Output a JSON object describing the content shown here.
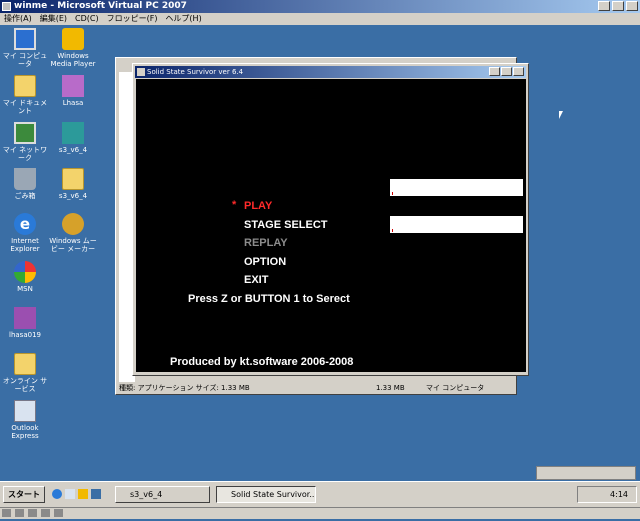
{
  "vpc": {
    "title": "winme - Microsoft Virtual PC 2007",
    "menu": [
      "操作(A)",
      "編集(E)",
      "CD(C)",
      "フロッピー(F)",
      "ヘルプ(H)"
    ]
  },
  "desktop": {
    "icons": [
      {
        "label": "マイ コンピュータ",
        "icon": "my-computer-icon"
      },
      {
        "label": "Windows Media Player",
        "icon": "media-player-icon"
      },
      {
        "label": "マイ ドキュメント",
        "icon": "my-documents-icon"
      },
      {
        "label": "Lhasa",
        "icon": "lhasa-icon"
      },
      {
        "label": "マイ ネットワーク",
        "icon": "network-icon"
      },
      {
        "label": "s3_v6_4",
        "icon": "s3-zip-icon"
      },
      {
        "label": "ごみ箱",
        "icon": "recycle-bin-icon"
      },
      {
        "label": "s3_v6_4",
        "icon": "folder-icon"
      },
      {
        "label": "Internet Explorer",
        "icon": "ie-icon"
      },
      {
        "label": "Windows ムービー メーカー",
        "icon": "movie-maker-icon"
      },
      {
        "label": "MSN",
        "icon": "msn-icon"
      },
      {
        "label": "lhasa019",
        "icon": "lhasa019-icon"
      },
      {
        "label": "オンライン サービス",
        "icon": "folder-icon"
      },
      {
        "label": "Outlook Express",
        "icon": "outlook-express-icon"
      }
    ]
  },
  "explorer": {
    "status_left": "種類: アプリケーション サイズ: 1.33 MB",
    "status_size": "1.33 MB",
    "status_location": "マイ コンピュータ"
  },
  "game": {
    "title": "Solid State Survivor ver 6.4",
    "cursor": "*",
    "menu": [
      {
        "label": "PLAY",
        "color": "#ff2a2a"
      },
      {
        "label": "STAGE SELECT",
        "color": "#ffffff"
      },
      {
        "label": "REPLAY",
        "color": "#8c8c8c"
      },
      {
        "label": "OPTION",
        "color": "#ffffff"
      },
      {
        "label": "EXIT",
        "color": "#ffffff"
      }
    ],
    "hint": "Press  Z  or BUTTON 1 to Serect",
    "credit": "Produced by kt.software 2006-2008"
  },
  "taskbar": {
    "start": "スタート",
    "tasks": [
      "s3_v6_4",
      "Solid State Survivor..."
    ],
    "clock": "4:14"
  }
}
